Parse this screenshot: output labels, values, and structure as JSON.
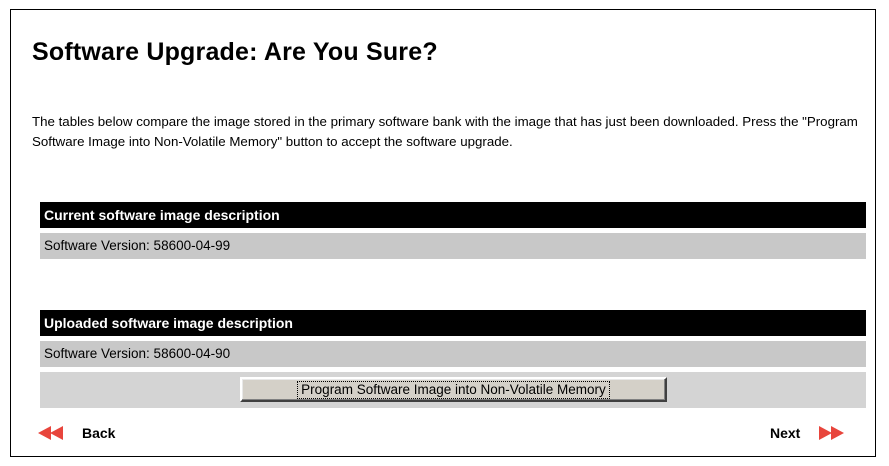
{
  "page": {
    "title": "Software Upgrade: Are You Sure?",
    "intro": "The tables below compare the image stored in the primary software bank with the image that has just been downloaded. Press the \"Program Software Image into Non-Volatile Memory\" button to accept the software upgrade."
  },
  "current_image": {
    "header": "Current software image description",
    "version": "Software Version: 58600-04-99"
  },
  "uploaded_image": {
    "header": "Uploaded software image description",
    "version": "Software Version: 58600-04-90"
  },
  "actions": {
    "program_button_label": "Program Software Image into Non-Volatile Memory"
  },
  "navigation": {
    "back_label": "Back",
    "next_label": "Next",
    "back_icon": "double-arrow-left-icon",
    "next_icon": "double-arrow-right-icon"
  },
  "colors": {
    "header_bg": "#000000",
    "row_bg": "#c8c8c8",
    "arrow": "#e8453c"
  }
}
